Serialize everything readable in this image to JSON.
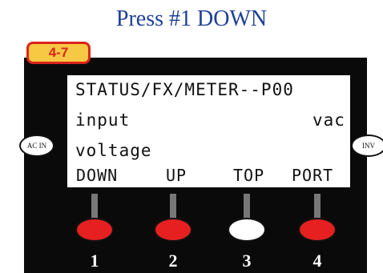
{
  "page_title": "Press #1 DOWN",
  "step_tag": "4-7",
  "display": {
    "line1": "STATUS/FX/METER--P00",
    "line2_left": "input",
    "line2_right": "vac",
    "line3": "voltage"
  },
  "softkeys": [
    "DOWN",
    "UP",
    "TOP",
    "PORT"
  ],
  "side_labels": {
    "left": "AC IN",
    "right": "INV"
  },
  "buttons": [
    {
      "number": "1",
      "color": "#e62020"
    },
    {
      "number": "2",
      "color": "#e62020"
    },
    {
      "number": "3",
      "color": "#ffffff"
    },
    {
      "number": "4",
      "color": "#e62020"
    }
  ],
  "colors": {
    "title": "#1f3f99",
    "panel": "#0a0a0a",
    "tag_fill": "#f7c843",
    "tag_border": "#d9251c"
  }
}
